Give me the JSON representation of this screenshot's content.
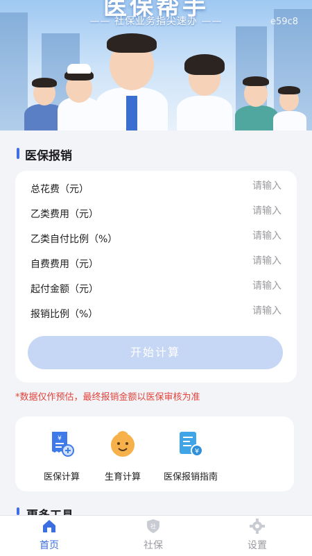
{
  "banner": {
    "title": "医保帮手",
    "subtitle": "—— 社保业务指尖速办 ——",
    "code": "e59c8"
  },
  "reimbursement": {
    "title": "医保报销",
    "fields": [
      {
        "label": "总花费（元）",
        "placeholder": "请输入",
        "value": ""
      },
      {
        "label": "乙类费用（元）",
        "placeholder": "请输入",
        "value": ""
      },
      {
        "label": "乙类自付比例（%）",
        "placeholder": "请输入",
        "value": ""
      },
      {
        "label": "自费费用（元）",
        "placeholder": "请输入",
        "value": ""
      },
      {
        "label": "起付金额（元）",
        "placeholder": "请输入",
        "value": ""
      },
      {
        "label": "报销比例（%）",
        "placeholder": "请输入",
        "value": ""
      }
    ],
    "calc_button": "开始计算",
    "notice": "*数据仅作预估，最终报销金额以医保审核为准"
  },
  "tools": [
    {
      "label": "医保计算",
      "icon": "receipt-calculator-icon"
    },
    {
      "label": "生育计算",
      "icon": "baby-face-icon"
    },
    {
      "label": "医保报销指南",
      "icon": "reimbursement-guide-icon"
    }
  ],
  "more_tools": {
    "title": "更多工具"
  },
  "tabbar": {
    "items": [
      {
        "label": "首页",
        "icon": "home-icon",
        "active": true
      },
      {
        "label": "社保",
        "icon": "shield-icon",
        "active": false
      },
      {
        "label": "设置",
        "icon": "gear-icon",
        "active": false
      }
    ],
    "active_color": "#3b6fe0",
    "inactive_color": "#9a9aa0"
  },
  "colors": {
    "accent": "#3f6ee8",
    "button_disabled": "#c6d6f5",
    "notice_red": "#e2433b",
    "page_bg": "#f3f4f8"
  }
}
